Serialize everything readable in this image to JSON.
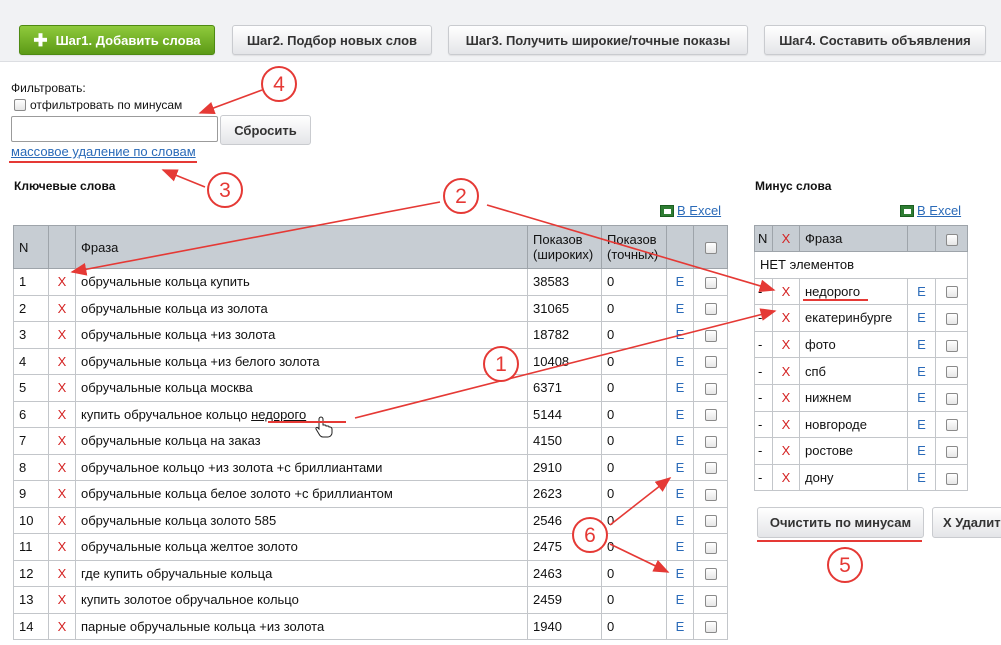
{
  "steps": {
    "step1": "Шаг1. Добавить слова",
    "step2": "Шаг2. Подбор новых слов",
    "step3": "Шаг3. Получить широкие/точные показы",
    "step4": "Шаг4. Составить объявления"
  },
  "filter": {
    "label": "Фильтровать:",
    "checkbox_label": "отфильтровать по минусам",
    "input_value": "",
    "reset_label": "Сбросить",
    "mass_delete_link": "массовое удаление по словам"
  },
  "keywords": {
    "title": "Ключевые слова",
    "excel_link": "В Excel",
    "columns": {
      "n": "N",
      "phrase": "Фраза",
      "broad_line1": "Показов",
      "broad_line2": "(широких)",
      "exact_line1": "Показов",
      "exact_line2": "(точных)"
    },
    "delete_mark": "X",
    "edit_mark": "E",
    "rows": [
      {
        "n": "1",
        "phrase": "обручальные кольца купить",
        "broad": "38583",
        "exact": "0"
      },
      {
        "n": "2",
        "phrase": "обручальные кольца из золота",
        "broad": "31065",
        "exact": "0"
      },
      {
        "n": "3",
        "phrase": "обручальные кольца +из золота",
        "broad": "18782",
        "exact": "0"
      },
      {
        "n": "4",
        "phrase": "обручальные кольца +из белого золота",
        "broad": "10408",
        "exact": "0"
      },
      {
        "n": "5",
        "phrase": "обручальные кольца москва",
        "broad": "6371",
        "exact": "0"
      },
      {
        "n": "6",
        "phrase": "купить обручальное кольцо ",
        "phrase_highlight": "недорого",
        "broad": "5144",
        "exact": "0"
      },
      {
        "n": "7",
        "phrase": "обручальные кольца на заказ",
        "broad": "4150",
        "exact": "0"
      },
      {
        "n": "8",
        "phrase": "обручальное кольцо +из золота +с бриллиантами",
        "broad": "2910",
        "exact": "0"
      },
      {
        "n": "9",
        "phrase": "обручальные кольца белое золото +с бриллиантом",
        "broad": "2623",
        "exact": "0"
      },
      {
        "n": "10",
        "phrase": "обручальные кольца золото 585",
        "broad": "2546",
        "exact": "0"
      },
      {
        "n": "11",
        "phrase": "обручальные кольца желтое золото",
        "broad": "2475",
        "exact": "0"
      },
      {
        "n": "12",
        "phrase": "где купить обручальные кольца",
        "broad": "2463",
        "exact": "0"
      },
      {
        "n": "13",
        "phrase": "купить золотое обручальное кольцо",
        "broad": "2459",
        "exact": "0"
      },
      {
        "n": "14",
        "phrase": "парные обручальные кольца +из золота",
        "broad": "1940",
        "exact": "0"
      }
    ]
  },
  "minus": {
    "title": "Минус слова",
    "excel_link": "В Excel",
    "columns": {
      "n": "N",
      "x": "X",
      "phrase": "Фраза"
    },
    "empty_text": "НЕТ элементов",
    "row_n": "-",
    "delete_mark": "X",
    "edit_mark": "E",
    "rows": [
      "недорого",
      "екатеринбурге",
      "фото",
      "спб",
      "нижнем",
      "новгороде",
      "ростове",
      "дону"
    ],
    "clear_label": "Очистить по минусам",
    "delete_label": "X Удалить"
  },
  "annotations": {
    "n1": "1",
    "n2": "2",
    "n3": "3",
    "n4": "4",
    "n5": "5",
    "n6": "6",
    "color": "#e53935"
  },
  "colors": {
    "primary_green": "#6aab1f",
    "link_blue": "#2a6ab8",
    "delete_red": "#d42323",
    "header_gray": "#c7cdd3"
  }
}
